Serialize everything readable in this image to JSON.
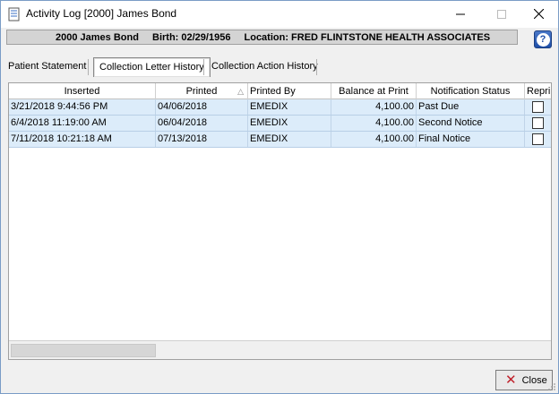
{
  "window": {
    "title": "Activity Log [2000] James Bond",
    "controls": [
      "minimize-icon",
      "maximize-icon",
      "close-icon"
    ]
  },
  "patient": {
    "id_name": "2000 James Bond",
    "birth": "Birth: 02/29/1956",
    "location": "Location: FRED FLINTSTONE HEALTH ASSOCIATES"
  },
  "help": {
    "icon": "help-icon"
  },
  "tabs": [
    {
      "label": "Patient Statement",
      "active": false
    },
    {
      "label": "Collection Letter History",
      "active": true
    },
    {
      "label": "Collection Action History",
      "active": false
    }
  ],
  "grid": {
    "columns": [
      "Inserted",
      "Printed",
      "Printed By",
      "Balance at Print",
      "Notification Status",
      "Repri"
    ],
    "sorted_column": "Printed",
    "rows": [
      {
        "inserted": "3/21/2018 9:44:56 PM",
        "printed": "04/06/2018",
        "printed_by": "EMEDIX",
        "balance": "4,100.00",
        "status": "Past Due",
        "reprint": false
      },
      {
        "inserted": "6/4/2018 11:19:00 AM",
        "printed": "06/04/2018",
        "printed_by": "EMEDIX",
        "balance": "4,100.00",
        "status": "Second Notice",
        "reprint": false
      },
      {
        "inserted": "7/11/2018 10:21:18 AM",
        "printed": "07/13/2018",
        "printed_by": "EMEDIX",
        "balance": "4,100.00",
        "status": "Final Notice",
        "reprint": false
      }
    ]
  },
  "footer": {
    "close_label": "Close"
  },
  "colors": {
    "row_bg": "#dcecfa",
    "close_x": "#c0202a",
    "help_bg": "#1f4fa8"
  }
}
